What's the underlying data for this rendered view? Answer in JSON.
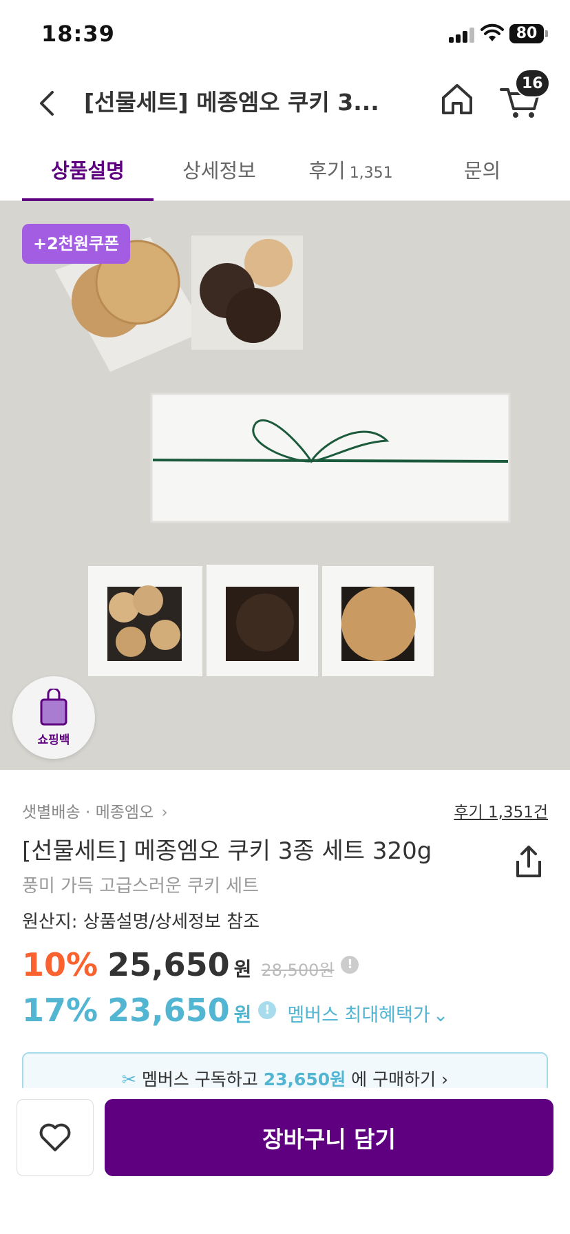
{
  "status_bar": {
    "time": "18:39",
    "battery": "80"
  },
  "header": {
    "title": "[선물세트] 메종엠오 쿠키 3...",
    "cart_count": "16"
  },
  "tabs": [
    {
      "label": "상품설명",
      "active": true
    },
    {
      "label": "상세정보",
      "active": false
    },
    {
      "label": "후기",
      "count": "1,351",
      "active": false
    },
    {
      "label": "문의",
      "active": false
    }
  ],
  "image": {
    "coupon_badge": "+2천원쿠폰",
    "shopping_bag_label": "쇼핑백"
  },
  "product": {
    "delivery": "샛별배송 · 메종엠오",
    "review_link": "후기 1,351건",
    "name": "[선물세트] 메종엠오 쿠키 3종 세트 320g",
    "subtitle": "풍미 가득 고급스러운 쿠키 세트",
    "origin": "원산지: 상품설명/상세정보 참조"
  },
  "pricing": {
    "discount_rate": "10%",
    "price": "25,650",
    "currency": "원",
    "original_price": "28,500원",
    "member_discount_rate": "17%",
    "member_price": "23,650",
    "member_currency": "원",
    "member_link": "멤버스 최대혜택가"
  },
  "member_banner": {
    "prefix": "멤버스 구독하고 ",
    "price": "23,650원",
    "suffix": " 에 구매하기"
  },
  "bottom_bar": {
    "add_to_cart": "장바구니 담기"
  },
  "colors": {
    "brand_purple": "#5f0080",
    "coupon_purple": "#a35de2",
    "discount_orange": "#fa622f",
    "member_blue": "#52b5d2"
  }
}
